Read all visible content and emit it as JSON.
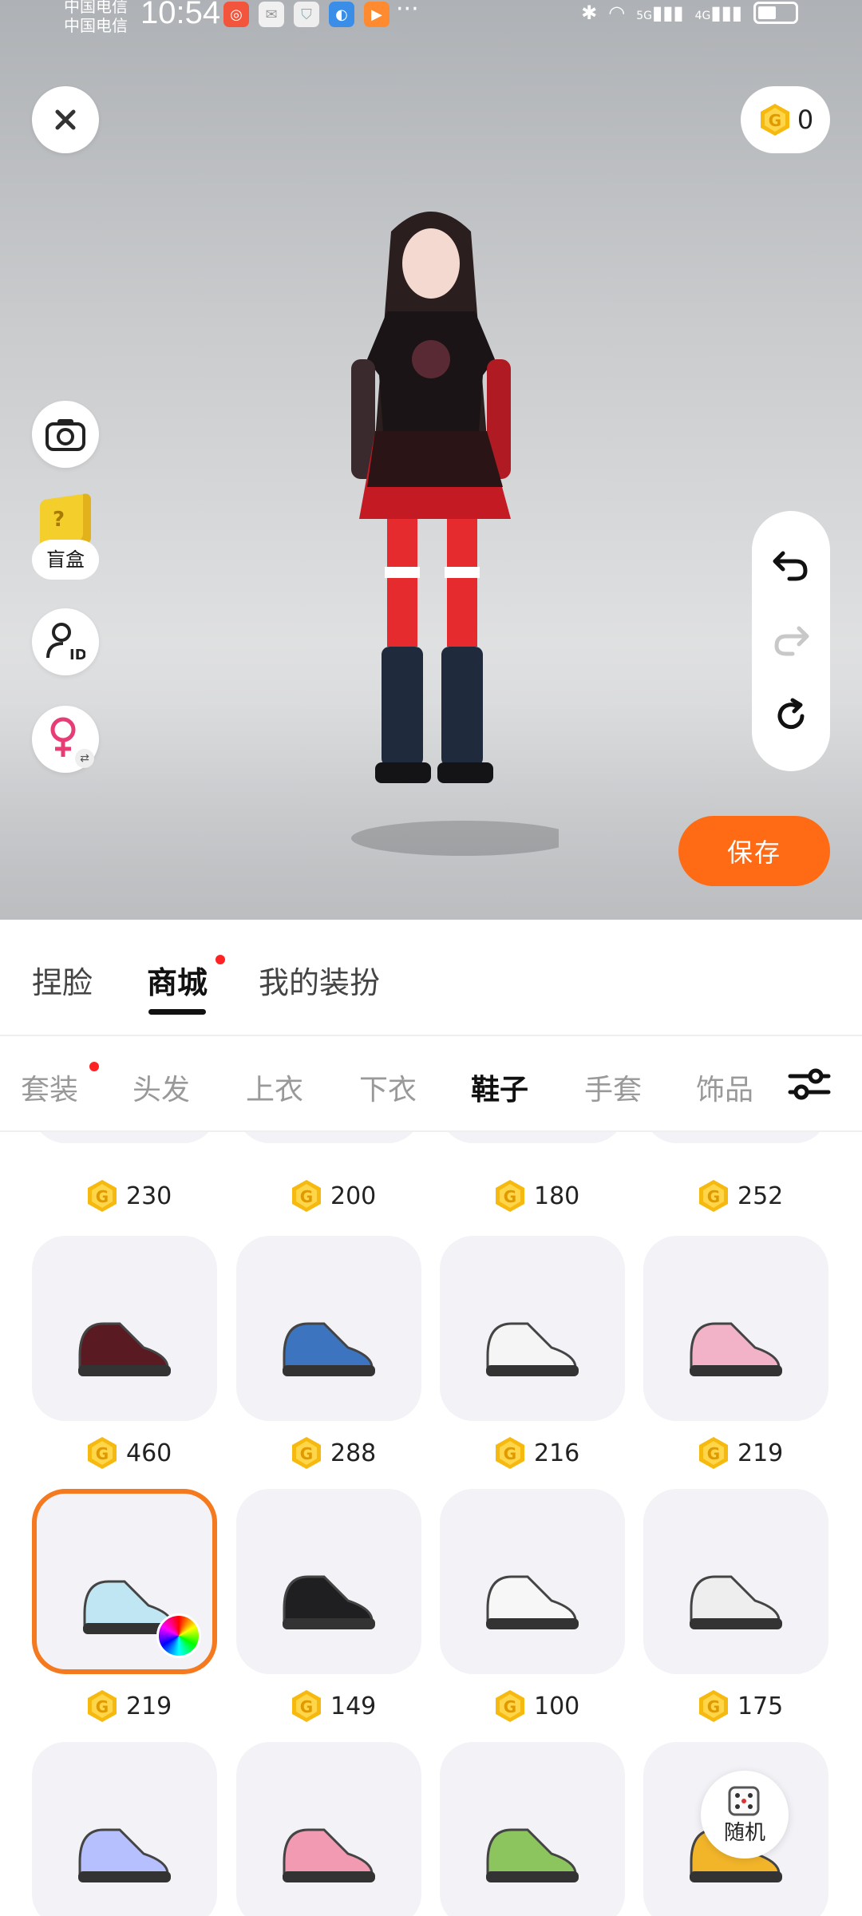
{
  "status_bar": {
    "carrier_1": "中国电信",
    "carrier_2": "中国电信",
    "time": "10:54",
    "more": "···",
    "net_1": "5G",
    "net_2": "4G"
  },
  "header": {
    "coins": "0"
  },
  "left_tools": {
    "blind_box_label": "盲盒",
    "blind_box_glyph": "?"
  },
  "actions": {
    "save_label": "保存",
    "random_label": "随机"
  },
  "main_tabs": [
    {
      "label": "捏脸",
      "active": false,
      "badge": false
    },
    {
      "label": "商城",
      "active": true,
      "badge": true
    },
    {
      "label": "我的装扮",
      "active": false,
      "badge": false
    }
  ],
  "category_tabs": [
    {
      "label": "套装",
      "active": false,
      "badge": true
    },
    {
      "label": "头发",
      "active": false,
      "badge": false
    },
    {
      "label": "上衣",
      "active": false,
      "badge": false
    },
    {
      "label": "下衣",
      "active": false,
      "badge": false
    },
    {
      "label": "鞋子",
      "active": true,
      "badge": false
    },
    {
      "label": "手套",
      "active": false,
      "badge": false
    },
    {
      "label": "饰品",
      "active": false,
      "badge": false
    }
  ],
  "items": [
    {
      "price": "230",
      "selected": false
    },
    {
      "price": "200",
      "selected": false
    },
    {
      "price": "180",
      "selected": false
    },
    {
      "price": "252",
      "selected": false
    },
    {
      "price": "460",
      "selected": false
    },
    {
      "price": "288",
      "selected": false
    },
    {
      "price": "216",
      "selected": false
    },
    {
      "price": "219",
      "selected": false
    },
    {
      "price": "219",
      "selected": true
    },
    {
      "price": "149",
      "selected": false
    },
    {
      "price": "100",
      "selected": false
    },
    {
      "price": "175",
      "selected": false
    },
    {
      "price": "",
      "selected": false
    },
    {
      "price": "",
      "selected": false
    },
    {
      "price": "",
      "selected": false
    },
    {
      "price": "",
      "selected": false
    }
  ],
  "colors": {
    "accent": "#ff6a14",
    "selected_border": "#f4791f",
    "coin": "#f6b90f",
    "badge": "#ff2222"
  }
}
